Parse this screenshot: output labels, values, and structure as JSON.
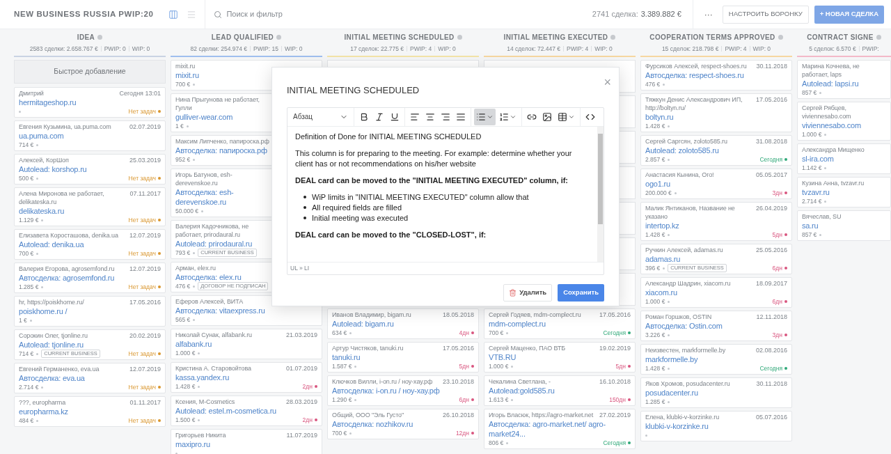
{
  "header": {
    "title": "NEW BUSINESS RUSSIA PWIP:20",
    "views": [
      {
        "kind": "board",
        "selected": true
      },
      {
        "kind": "list",
        "selected": false
      }
    ],
    "search": {
      "placeholder": "Поиск и фильтр"
    },
    "totals": {
      "count": "2741 сделка:",
      "sum": "3.389.882 €"
    },
    "more": "···",
    "configure": "НАСТРОИТЬ ВОРОНКУ",
    "new_deal": "+ НОВАЯ СДЕЛКА"
  },
  "columns": [
    {
      "name": "IDEA",
      "color": "#c9d3e3",
      "stats": [
        "2583 сделки: 2.658.767 €",
        "PWIP: 0",
        "WIP: 0"
      ],
      "quick_add": "Быстрое добавление",
      "cards": [
        {
          "contact": "Дмитрий",
          "date": "Сегодня 13:01",
          "title": "hermitageshop.ru",
          "status": {
            "text": "Нет задач",
            "color": "#d9962e"
          }
        },
        {
          "contact": "Евгения Кузьмина, ua.puma.com",
          "date": "02.07.2019",
          "title": "ua.puma.com",
          "amount": "714 €"
        },
        {
          "contact": "Алексей, КорШоп",
          "date": "25.03.2019",
          "title": "Autolead: korshop.ru",
          "amount": "500 €",
          "status": {
            "text": "Нет задач",
            "color": "#d9962e"
          }
        },
        {
          "contact": "Алена Миронова не работает, delikateska.ru",
          "date": "07.11.2017",
          "title": "delikateska.ru",
          "amount": "1.129 €",
          "status": {
            "text": "Нет задач",
            "color": "#d9962e"
          }
        },
        {
          "contact": "Елизавета Коросташова, denika.ua",
          "date": "12.07.2019",
          "title": "Autolead: denika.ua",
          "amount": "700 €",
          "status": {
            "text": "Нет задач",
            "color": "#d9962e"
          }
        },
        {
          "contact": "Валерия Егорова, agrosemfond.ru",
          "date": "12.07.2019",
          "title": "Автосделка: agrosemfond.ru",
          "amount": "1.285 €",
          "status": {
            "text": "Нет задач",
            "color": "#d9962e"
          }
        },
        {
          "contact": "hr, https://poiskhome.ru/",
          "date": "17.05.2016",
          "title": "poiskhome.ru /",
          "amount": "1 €"
        },
        {
          "contact": "Сорокин Олег, tjonline.ru",
          "date": "20.02.2019",
          "title": "Autolead: tjonline.ru",
          "amount": "714 €",
          "tag": "CURRENT BUSINESS",
          "status": {
            "text": "Нет задач",
            "color": "#d9962e"
          }
        },
        {
          "contact": "Евгений Германенко, eva.ua",
          "date": "12.07.2019",
          "title": "Автосделка: eva.ua",
          "amount": "2.714 €",
          "status": {
            "text": "Нет задач",
            "color": "#d9962e"
          }
        },
        {
          "contact": "???, europharma",
          "date": "01.11.2017",
          "title": "europharma.kz",
          "amount": "484 €",
          "status": {
            "text": "Нет задач",
            "color": "#d9962e"
          }
        }
      ]
    },
    {
      "name": "LEAD QUALIFIED",
      "color": "#9fbfee",
      "stats": [
        "82 сделки: 254.974 €",
        "PWIP: 15",
        "WIP: 0"
      ],
      "cards": [
        {
          "contact": "mixit.ru",
          "title": "mixit.ru",
          "amount": "700 €"
        },
        {
          "contact": "Нина Прыгунова не работает, Гулли",
          "title": "gulliver-wear.com",
          "amount": "1 €"
        },
        {
          "contact": "Максим Липченко, папироска.рф",
          "title": "Автосделка: папироска.рф",
          "amount": "952 €"
        },
        {
          "contact": "Игорь Батунов, esh-derevenskoe.ru",
          "title": "Автосделка: esh-derevenskoe.ru",
          "amount": "50.000 €"
        },
        {
          "contact": "Валерия Кадочникова, не работает, prirodaural.ru",
          "title": "Autolead: prirodaural.ru",
          "amount": "793 €",
          "tag": "CURRENT BUSINESS"
        },
        {
          "contact": "Арман, elex.ru",
          "title": "Автосделка: elex.ru",
          "amount": "476 €",
          "tag": "ДОГОВОР НЕ ПОДПИСАН"
        },
        {
          "contact": "Еферов Алексей, ВИТА",
          "title": "Автосделка: vitaexpress.ru",
          "amount": "565 €"
        },
        {
          "contact": "Николай Сунак, alfabank.ru",
          "date": "21.03.2019",
          "title": "alfabank.ru",
          "amount": "1.000 €"
        },
        {
          "contact": "Кристина А. Старовойтова",
          "date": "01.07.2019",
          "title": "kassa.yandex.ru",
          "amount": "1.428 €",
          "status": {
            "text": "2дн",
            "color": "#d9557f"
          }
        },
        {
          "contact": "Ксения, M-Cosmetics",
          "date": "28.03.2019",
          "title": "Autolead: estel.m-cosmetica.ru",
          "amount": "1.500 €",
          "status": {
            "text": "2дн",
            "color": "#d9557f"
          }
        },
        {
          "contact": "Григорьев Никита",
          "date": "11.07.2019",
          "title": "maxipro.ru"
        }
      ]
    },
    {
      "name": "INITIAL MEETING SCHEDULED",
      "color": "#f3e4a8",
      "stats": [
        "17 сделок: 22.775 €",
        "PWIP: 4",
        "WIP: 0"
      ],
      "cards": [
        {
          "contact": "Иванов Владимир, bigam.ru",
          "date": "18.05.2018",
          "title": "Autolead: bigam.ru",
          "amount": "634 €",
          "status": {
            "text": "4дн",
            "color": "#d9557f"
          }
        },
        {
          "contact": "Артур Чистяков, tanuki.ru",
          "date": "17.05.2016",
          "title": "tanuki.ru",
          "amount": "1.587 €",
          "status": {
            "text": "5дн",
            "color": "#d9557f"
          }
        },
        {
          "contact": "Ключков Вилли, i-on.ru / ноу-хау.рф",
          "date": "23.10.2018",
          "title": "Автосделка: i-on.ru / ноу-хау.рф",
          "amount": "1.290 €",
          "status": {
            "text": "6дн",
            "color": "#d9557f"
          }
        },
        {
          "contact": "Общий, ООО \"Эль Густо\"",
          "date": "26.10.2018",
          "title": "Автосделка: nozhikov.ru",
          "amount": "700 €",
          "status": {
            "text": "12дн",
            "color": "#d9557f"
          }
        }
      ]
    },
    {
      "name": "INITIAL MEETING EXECUTED",
      "color": "#f6d7a0",
      "stats": [
        "14 сделок: 72.447 €",
        "PWIP: 4",
        "WIP: 0"
      ],
      "cards": [
        {
          "contact": "Сергей Годяев, mdm-complect.ru",
          "date": "17.05.2016",
          "title": "mdm-complect.ru",
          "amount": "700 €",
          "status": {
            "text": "Сегодня",
            "color": "#2fa878"
          }
        },
        {
          "contact": "Сергей Маценко, ПАО ВТБ",
          "date": "19.02.2019",
          "title": "VTB.RU",
          "amount": "1.000 €",
          "status": {
            "text": "5дн",
            "color": "#d9557f"
          }
        },
        {
          "contact": "Чекалина Светлана, -",
          "date": "16.10.2018",
          "title": "Autolead:gold585.ru",
          "amount": "1.613 €",
          "status": {
            "text": "150дн",
            "color": "#d9557f"
          }
        },
        {
          "contact": "Игорь Власюк, https://agro-market.net",
          "date": "27.02.2019",
          "title": "Автосделка: agro-market.net/ agro-market24...",
          "amount": "806 €",
          "status": {
            "text": "Сегодня",
            "color": "#2fa878"
          }
        }
      ]
    },
    {
      "name": "COOPERATION TERMS APPROVED",
      "color": "#f6d7a0",
      "stats": [
        "15 сделок: 218.798 €",
        "PWIP: 4",
        "WIP: 0"
      ],
      "cards": [
        {
          "contact": "Фурсиков Алексей, respect-shoes.ru",
          "date": "30.11.2018",
          "title": "Автосделка: respect-shoes.ru",
          "amount": "476 €"
        },
        {
          "contact": "Тяжкун Денис Александрович ИП, http://boltyn.ru/",
          "date": "17.05.2016",
          "title": "boltyn.ru",
          "amount": "1.428 €"
        },
        {
          "contact": "Сергей Саргсян, zoloto585.ru",
          "date": "31.08.2018",
          "title": "Autolead: zoloto585.ru",
          "amount": "2.857 €",
          "status": {
            "text": "Сегодня",
            "color": "#2fa878"
          }
        },
        {
          "contact": "Анастасия Кынина, Ого!",
          "date": "05.05.2017",
          "title": "ogo1.ru",
          "amount": "200.000 €",
          "status": {
            "text": "3дн",
            "color": "#d9557f"
          }
        },
        {
          "contact": "Малик Янтиканов, Название не указано",
          "date": "26.04.2019",
          "title": "intertop.kz",
          "amount": "1.428 €",
          "status": {
            "text": "5дн",
            "color": "#d9557f"
          }
        },
        {
          "contact": "Ручкин Алексей, adamas.ru",
          "date": "25.05.2016",
          "title": "adamas.ru",
          "amount": "396 €",
          "tag": "CURRENT BUSINESS",
          "status": {
            "text": "6дн",
            "color": "#d9557f"
          }
        },
        {
          "contact": "Александр Шадрин, xiacom.ru",
          "date": "18.09.2017",
          "title": "xiacom.ru",
          "amount": "1.000 €",
          "status": {
            "text": "6дн",
            "color": "#d9557f"
          }
        },
        {
          "contact": "Роман Горшков, OSTIN",
          "date": "12.11.2018",
          "title": "Автосделка: Ostin.com",
          "amount": "3.226 €",
          "status": {
            "text": "3дн",
            "color": "#d9557f"
          }
        },
        {
          "contact": "Неизвестен, markformelle.by",
          "date": "02.08.2016",
          "title": "markformelle.by",
          "amount": "1.428 €",
          "status": {
            "text": "Сегодня",
            "color": "#2fa878"
          }
        },
        {
          "contact": "Яков Хромов, posudacenter.ru",
          "date": "30.11.2018",
          "title": "posudacenter.ru",
          "amount": "1.285 €"
        },
        {
          "contact": "Елена, klubki-v-korzinke.ru",
          "date": "05.07.2016",
          "title": "klubki-v-korzinke.ru"
        }
      ]
    },
    {
      "name": "CONTRACT SIGNE",
      "color": "#f3b9c8",
      "stats": [
        "5 сделок: 6.570 €",
        "PWIP:"
      ],
      "cards": [
        {
          "contact": "Марина Кочнева, не работает, laps",
          "title": "Autolead: lapsi.ru",
          "amount": "857 €"
        },
        {
          "contact": "Сергей Рябцев, viviennesabo.com",
          "title": "viviennesabo.com",
          "amount": "1.000 €"
        },
        {
          "contact": "Александра Мищенко",
          "title": "sl-ira.com",
          "amount": "1.142 €"
        },
        {
          "contact": "Кузина Анна, tvzavr.ru",
          "title": "tvzavr.ru",
          "amount": "2.714 €"
        },
        {
          "contact": "Вячеслав, SU",
          "title": "sa.ru",
          "amount": "857 €"
        }
      ]
    }
  ],
  "modal": {
    "title": "INITIAL MEETING SCHEDULED",
    "close": "×",
    "editor": {
      "block_format": "Абзац",
      "toolbar": [
        [
          {
            "kind": "bold",
            "selected": false
          },
          {
            "kind": "italic",
            "selected": false
          },
          {
            "kind": "underline",
            "selected": false
          }
        ],
        [
          {
            "kind": "align_left",
            "selected": false
          },
          {
            "kind": "align_center",
            "selected": false
          },
          {
            "kind": "align_right",
            "selected": false
          },
          {
            "kind": "align_justify",
            "selected": false
          }
        ],
        [
          {
            "kind": "bullet_list",
            "selected": true,
            "menu": true
          },
          {
            "kind": "numbered_list",
            "selected": false,
            "menu": true
          }
        ],
        [
          {
            "kind": "link",
            "selected": false
          },
          {
            "kind": "image",
            "selected": false
          },
          {
            "kind": "table",
            "selected": false,
            "menu": true
          }
        ],
        [
          {
            "kind": "code",
            "selected": false
          }
        ]
      ],
      "content": [
        {
          "kind": "paragraph",
          "text": "Definition of Done for INITIAL MEETING SCHEDULED"
        },
        {
          "kind": "paragraph",
          "text": "This column is for preparing to the meeting. For example: determine whether your client has or not recommendations on his/her website"
        },
        {
          "kind": "heading",
          "text": "DEAL card can be moved to the \"INITIAL MEETING EXECUTED\" column, if:"
        },
        {
          "kind": "list",
          "items": [
            "WiP limits in \"INITIAL MEETING EXECUTED\" column allow that",
            "All required fields are filled",
            "Initial meeting was executed"
          ]
        },
        {
          "kind": "heading",
          "text": "DEAL card can be moved to the \"CLOSED-LOST\", if:"
        }
      ],
      "path": "UL » LI"
    },
    "delete": "Удалить",
    "save": "Сохранить"
  }
}
